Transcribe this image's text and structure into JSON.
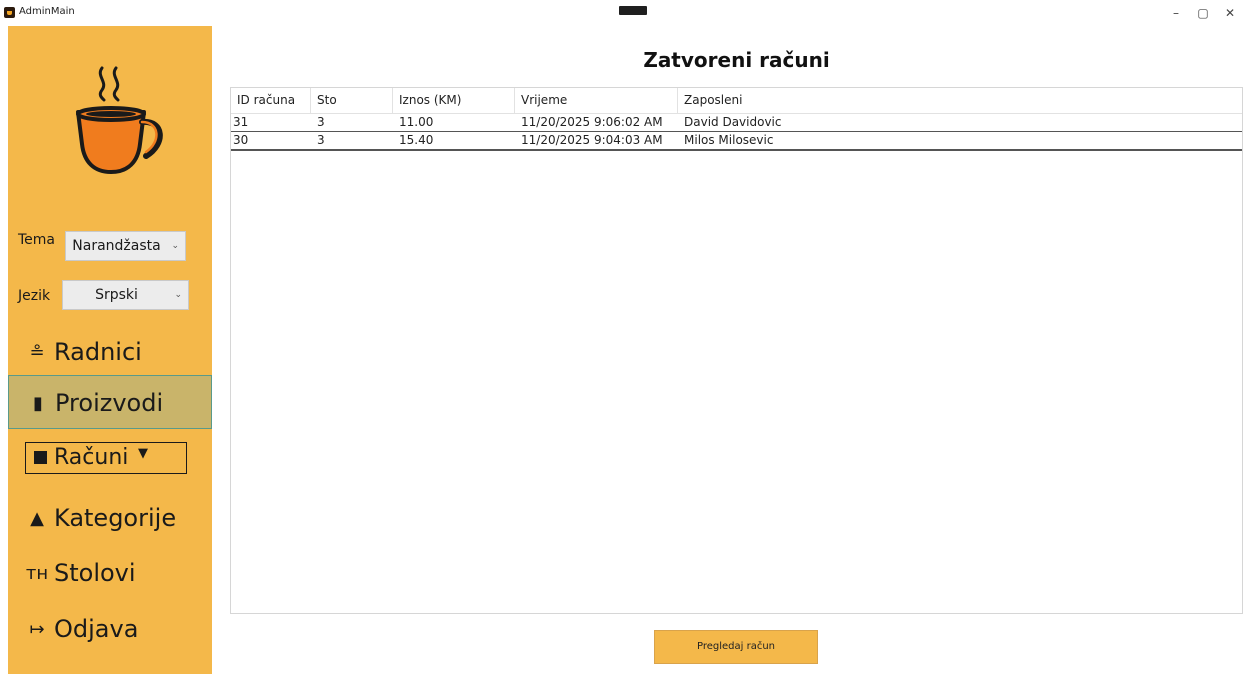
{
  "window": {
    "title": "AdminMain",
    "minimize_glyph": "–",
    "restore_glyph": "▢",
    "close_glyph": "✕"
  },
  "sidebar": {
    "logo_icon": "coffee-cup-icon",
    "theme": {
      "label": "Tema",
      "value": "Narandžasta"
    },
    "language": {
      "label": "Jezik",
      "value": "Srpski"
    },
    "nav": [
      {
        "label": "Radnici",
        "icon": "worker-icon",
        "glyph": "≗"
      },
      {
        "label": "Proizvodi",
        "icon": "glass-icon",
        "glyph": "▮"
      },
      {
        "label": "Računi",
        "icon": "square-icon",
        "caret": "▼"
      },
      {
        "label": "Kategorije",
        "icon": "shapes-icon",
        "glyph": "▲"
      },
      {
        "label": "Stolovi",
        "icon": "table-icon",
        "glyph": "ᴛн"
      },
      {
        "label": "Odjava",
        "icon": "logout-icon",
        "glyph": "↦"
      }
    ],
    "active_item": "Proizvodi",
    "accent_color": "#f4b84a"
  },
  "main": {
    "title": "Zatvoreni računi",
    "columns": [
      "ID računa",
      "Sto",
      "Iznos (KM)",
      "Vrijeme",
      "Zaposleni"
    ],
    "rows": [
      [
        "31",
        "3",
        "11.00",
        "11/20/2025 9:06:02 AM",
        "David Davidovic"
      ],
      [
        "30",
        "3",
        "15.40",
        "11/20/2025 9:04:03 AM",
        "Milos Milosevic"
      ]
    ],
    "action_button": "Pregledaj račun"
  }
}
